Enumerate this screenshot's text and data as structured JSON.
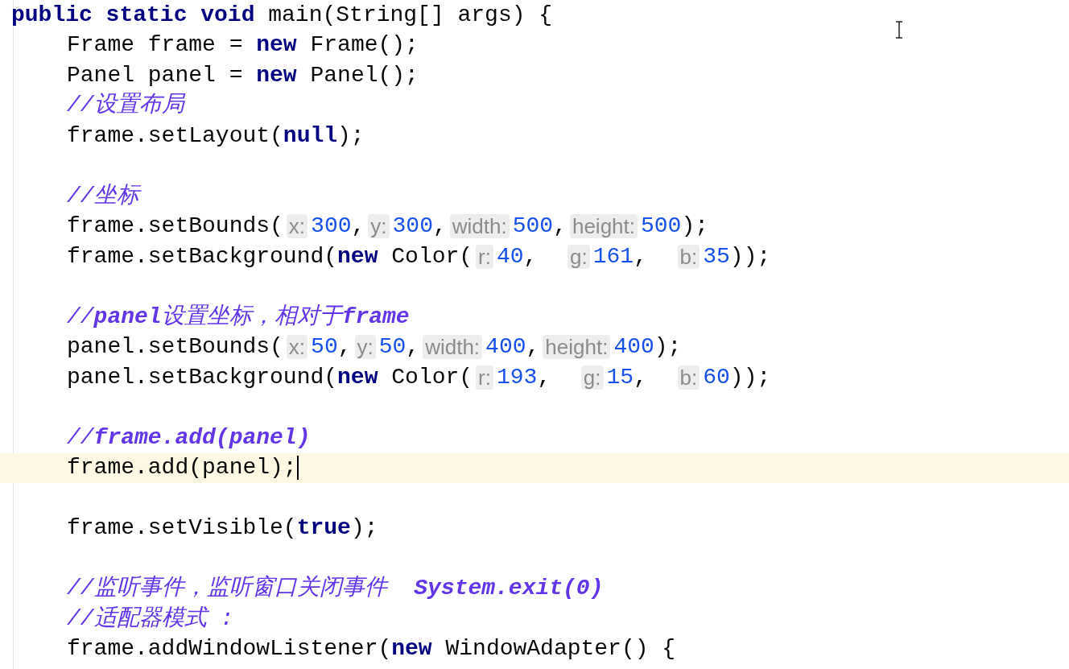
{
  "editor": {
    "header": {
      "current": false,
      "tokens": [
        {
          "kind": "keyword",
          "text": "public static void"
        },
        {
          "kind": "code",
          "text": " main(String[] args) {"
        }
      ]
    },
    "body": [
      {
        "current": false,
        "tokens": [
          {
            "kind": "code",
            "text": "Frame frame = "
          },
          {
            "kind": "keyword",
            "text": "new"
          },
          {
            "kind": "code",
            "text": " Frame();"
          }
        ]
      },
      {
        "current": false,
        "tokens": [
          {
            "kind": "code",
            "text": "Panel panel = "
          },
          {
            "kind": "keyword",
            "text": "new"
          },
          {
            "kind": "code",
            "text": " Panel();"
          }
        ]
      },
      {
        "current": false,
        "tokens": [
          {
            "kind": "comment",
            "text": "//设置布局"
          }
        ]
      },
      {
        "current": false,
        "tokens": [
          {
            "kind": "code",
            "text": "frame.setLayout("
          },
          {
            "kind": "keyword",
            "text": "null"
          },
          {
            "kind": "code",
            "text": ");"
          }
        ]
      },
      {
        "current": false,
        "kind": "blank"
      },
      {
        "current": false,
        "tokens": [
          {
            "kind": "comment",
            "text": "//坐标"
          }
        ]
      },
      {
        "current": false,
        "tokens": [
          {
            "kind": "code",
            "text": "frame.setBounds("
          },
          {
            "kind": "hint",
            "text": "x:"
          },
          {
            "kind": "number",
            "text": "300"
          },
          {
            "kind": "code",
            "text": ","
          },
          {
            "kind": "hint",
            "text": "y:"
          },
          {
            "kind": "number",
            "text": "300"
          },
          {
            "kind": "code",
            "text": ","
          },
          {
            "kind": "hint",
            "text": "width:"
          },
          {
            "kind": "number",
            "text": "500"
          },
          {
            "kind": "code",
            "text": ","
          },
          {
            "kind": "hint",
            "text": "height:"
          },
          {
            "kind": "number",
            "text": "500"
          },
          {
            "kind": "code",
            "text": ");"
          }
        ]
      },
      {
        "current": false,
        "tokens": [
          {
            "kind": "code",
            "text": "frame.setBackground("
          },
          {
            "kind": "keyword",
            "text": "new"
          },
          {
            "kind": "code",
            "text": " Color("
          },
          {
            "kind": "hint",
            "text": "r:"
          },
          {
            "kind": "number",
            "text": "40"
          },
          {
            "kind": "code",
            "text": ",  "
          },
          {
            "kind": "hint",
            "text": "g:"
          },
          {
            "kind": "number",
            "text": "161"
          },
          {
            "kind": "code",
            "text": ",  "
          },
          {
            "kind": "hint",
            "text": "b:"
          },
          {
            "kind": "number",
            "text": "35"
          },
          {
            "kind": "code",
            "text": "));"
          }
        ]
      },
      {
        "current": false,
        "kind": "blank"
      },
      {
        "current": false,
        "tokens": [
          {
            "kind": "comment",
            "text": "//**panel**设置坐标，相对于**frame**"
          }
        ]
      },
      {
        "current": false,
        "tokens": [
          {
            "kind": "code",
            "text": "panel.setBounds("
          },
          {
            "kind": "hint",
            "text": "x:"
          },
          {
            "kind": "number",
            "text": "50"
          },
          {
            "kind": "code",
            "text": ","
          },
          {
            "kind": "hint",
            "text": "y:"
          },
          {
            "kind": "number",
            "text": "50"
          },
          {
            "kind": "code",
            "text": ","
          },
          {
            "kind": "hint",
            "text": "width:"
          },
          {
            "kind": "number",
            "text": "400"
          },
          {
            "kind": "code",
            "text": ","
          },
          {
            "kind": "hint",
            "text": "height:"
          },
          {
            "kind": "number",
            "text": "400"
          },
          {
            "kind": "code",
            "text": ");"
          }
        ]
      },
      {
        "current": false,
        "tokens": [
          {
            "kind": "code",
            "text": "panel.setBackground("
          },
          {
            "kind": "keyword",
            "text": "new"
          },
          {
            "kind": "code",
            "text": " Color("
          },
          {
            "kind": "hint",
            "text": "r:"
          },
          {
            "kind": "number",
            "text": "193"
          },
          {
            "kind": "code",
            "text": ",  "
          },
          {
            "kind": "hint",
            "text": "g:"
          },
          {
            "kind": "number",
            "text": "15"
          },
          {
            "kind": "code",
            "text": ",  "
          },
          {
            "kind": "hint",
            "text": "b:"
          },
          {
            "kind": "number",
            "text": "60"
          },
          {
            "kind": "code",
            "text": "));"
          }
        ]
      },
      {
        "current": false,
        "kind": "blank"
      },
      {
        "current": false,
        "tokens": [
          {
            "kind": "comment",
            "text": "//**frame.add(panel)**"
          }
        ]
      },
      {
        "current": true,
        "tokens": [
          {
            "kind": "code",
            "text": "frame.add(panel);"
          }
        ]
      },
      {
        "current": false,
        "kind": "blank"
      },
      {
        "current": false,
        "tokens": [
          {
            "kind": "code",
            "text": "frame.setVisible("
          },
          {
            "kind": "keyword",
            "text": "true"
          },
          {
            "kind": "code",
            "text": ");"
          }
        ]
      },
      {
        "current": false,
        "kind": "blank"
      },
      {
        "current": false,
        "tokens": [
          {
            "kind": "comment",
            "text": "//监听事件，监听窗口关闭事件  **System.exit(0)**"
          }
        ]
      },
      {
        "current": false,
        "tokens": [
          {
            "kind": "comment",
            "text": "//适配器模式 :"
          }
        ]
      },
      {
        "current": false,
        "tokens": [
          {
            "kind": "code",
            "text": "frame.addWindowListener("
          },
          {
            "kind": "keyword",
            "text": "new"
          },
          {
            "kind": "code",
            "text": " WindowAdapter() {"
          }
        ]
      }
    ]
  }
}
